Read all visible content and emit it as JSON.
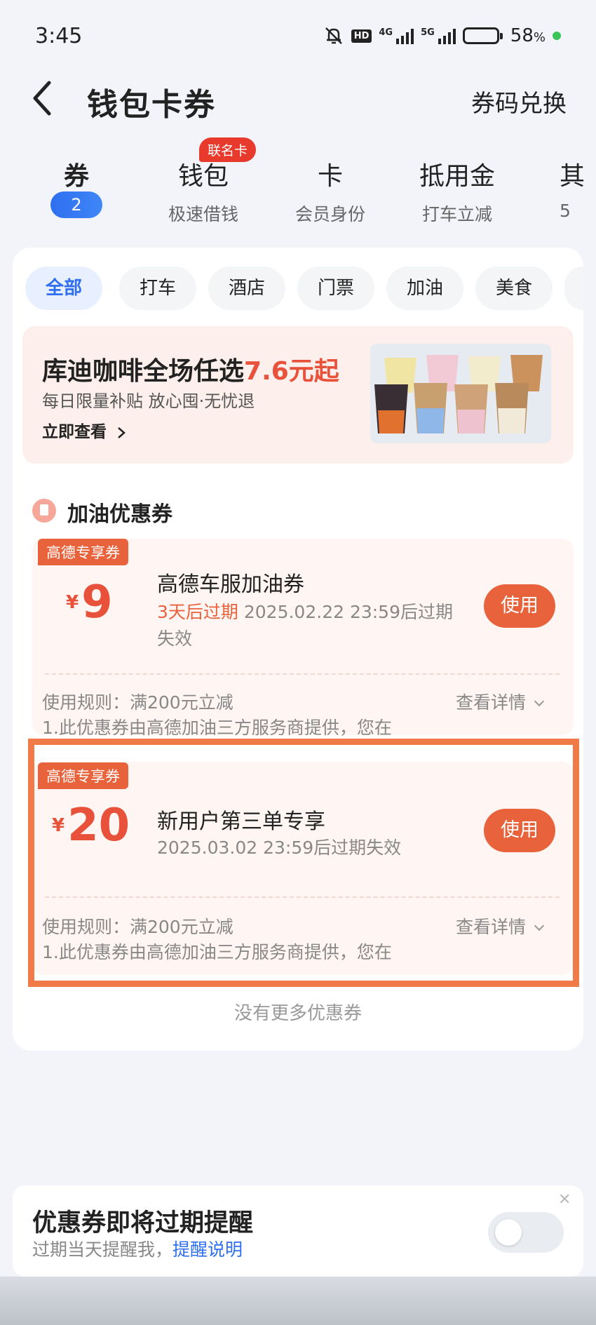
{
  "status_bar": {
    "time": "3:45",
    "network1": "4G",
    "network2": "5G",
    "hd": "HD",
    "battery": "58",
    "battery_unit": "%"
  },
  "header": {
    "title": "钱包卡券",
    "action": "券码兑换"
  },
  "tabs": [
    {
      "label": "券",
      "badge": "2"
    },
    {
      "label": "钱包",
      "sub": "极速借钱",
      "tag": "联名卡"
    },
    {
      "label": "卡",
      "sub": "会员身份"
    },
    {
      "label": "抵用金",
      "sub": "打车立减"
    },
    {
      "label": "其",
      "sub": "5"
    }
  ],
  "chips": [
    "全部",
    "打车",
    "酒店",
    "门票",
    "加油",
    "美食",
    ""
  ],
  "banner": {
    "title": "库迪咖啡全场任选",
    "title_highlight": "7.6元起",
    "subtitle": "每日限量补贴  放心囤·无忧退",
    "link": "立即查看"
  },
  "section": {
    "title": "加油优惠券"
  },
  "coupons": [
    {
      "tag": "高德专享券",
      "currency": "¥",
      "amount": "9",
      "name": "高德车服加油券",
      "warn": "3天后过期",
      "expiry": "2025.02.22 23:59后过期失效",
      "button": "使用",
      "rule": "使用规则：满200元立减",
      "rule_detail": "1.此优惠券由高德加油三方服务商提供，您在",
      "detail": "查看详情"
    },
    {
      "tag": "高德专享券",
      "currency": "¥",
      "amount": "20",
      "name": "新用户第三单专享",
      "expiry": "2025.03.02 23:59后过期失效",
      "button": "使用",
      "rule": "使用规则：满200元立减",
      "rule_detail": "1.此优惠券由高德加油三方服务商提供，您在",
      "detail": "查看详情"
    }
  ],
  "no_more": "没有更多优惠券",
  "reminder": {
    "title": "优惠券即将过期提醒",
    "subtitle": "过期当天提醒我，",
    "link": "提醒说明",
    "toggle_on": false
  },
  "colors": {
    "accent": "#e8633c",
    "blue": "#2f6ff0",
    "highlight_box": "#f07a48"
  }
}
